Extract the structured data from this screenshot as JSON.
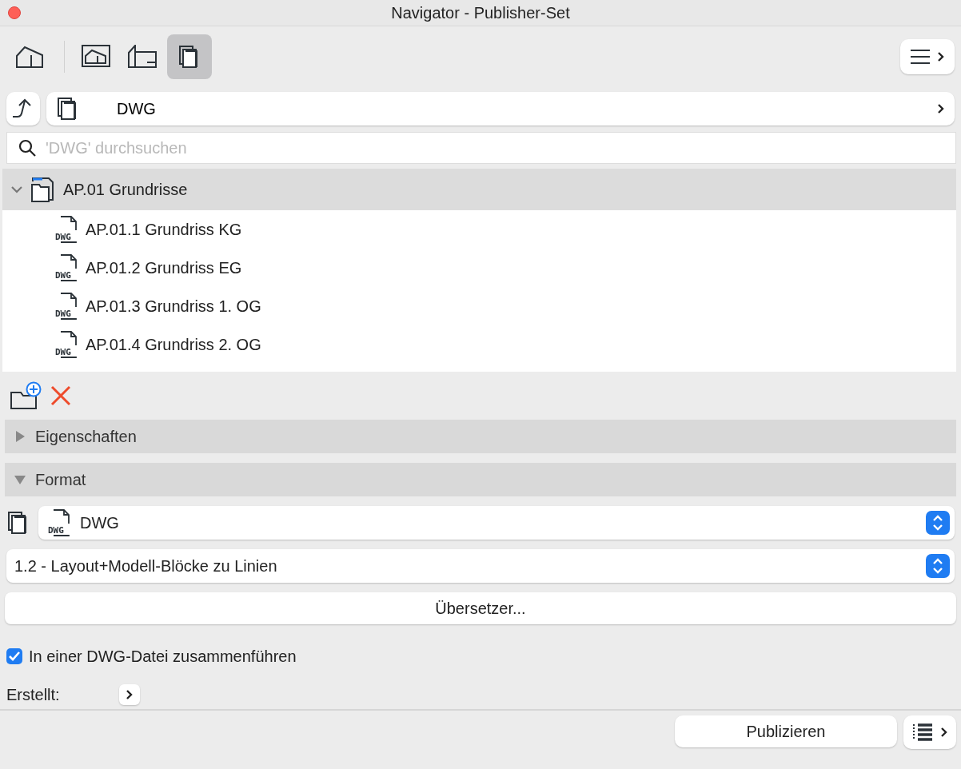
{
  "window": {
    "title": "Navigator - Publisher-Set"
  },
  "view_tabs": [
    {
      "kind": "model",
      "selected": false
    },
    {
      "kind": "layout",
      "selected": false
    },
    {
      "kind": "sheet",
      "selected": false
    },
    {
      "kind": "set",
      "selected": true
    }
  ],
  "path": {
    "label": "DWG"
  },
  "search": {
    "placeholder": "'DWG' durchsuchen"
  },
  "tree": [
    {
      "label": "AP.01 Grundrisse",
      "expanded": true,
      "selected": true,
      "children": [
        {
          "label": "AP.01.1 Grundriss KG",
          "badge": "DWG",
          "selected": false
        },
        {
          "label": "AP.01.2 Grundriss EG",
          "badge": "DWG",
          "selected": false
        },
        {
          "label": "AP.01.3 Grundriss 1. OG",
          "badge": "DWG",
          "selected": false
        },
        {
          "label": "AP.01.4 Grundriss 2. OG",
          "badge": "DWG",
          "selected": false
        }
      ]
    }
  ],
  "sections": [
    {
      "label": "Eigenschaften",
      "expanded": false
    },
    {
      "label": "Format",
      "expanded": true
    }
  ],
  "format": {
    "type": "DWG",
    "badge": "DWG",
    "translator": "1.2 - Layout+Modell-Blöcke zu Linien",
    "translator_button": "Übersetzer..."
  },
  "merge": {
    "label": "In einer DWG-Datei zusammenführen",
    "checked": true
  },
  "created": {
    "label": "Erstellt:"
  },
  "footer": {
    "publish": "Publizieren"
  }
}
